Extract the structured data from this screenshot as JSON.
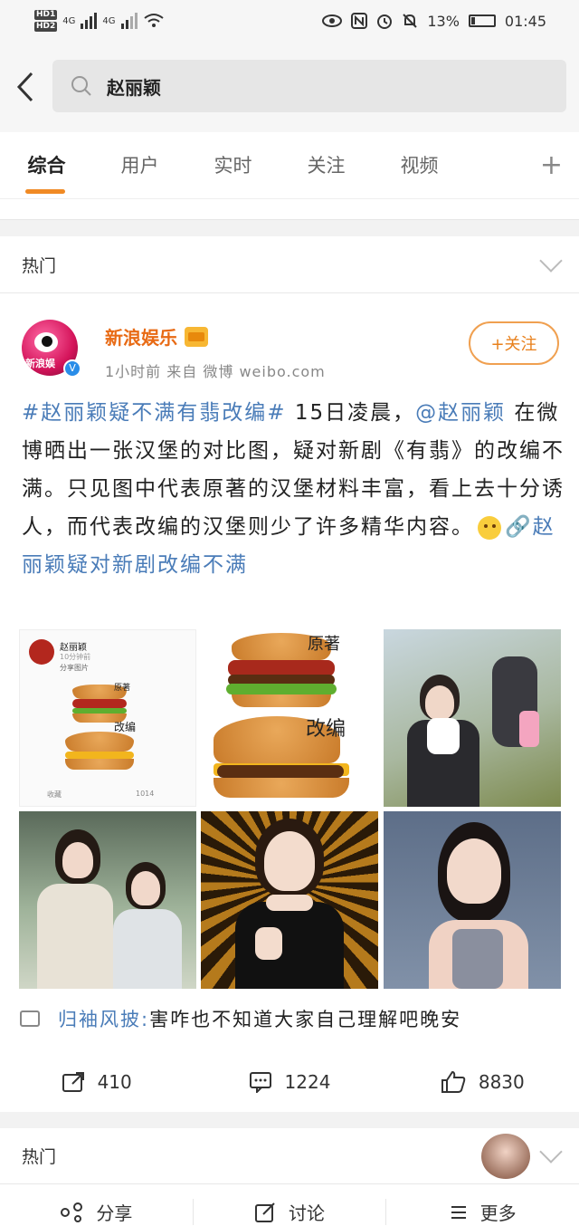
{
  "status_bar": {
    "battery": "13%",
    "time": "01:45",
    "net1": "4G",
    "net2": "4G"
  },
  "search": {
    "query": "赵丽颖"
  },
  "tabs": [
    {
      "label": "综合"
    },
    {
      "label": "用户"
    },
    {
      "label": "实时"
    },
    {
      "label": "关注"
    },
    {
      "label": "视频"
    }
  ],
  "section_title": "热门",
  "post": {
    "author": "新浪娱乐",
    "avatar_text": "新浪娱",
    "meta": "1小时前  来自 微博 weibo.com",
    "follow_label": "+关注",
    "text_hashtag": "#赵丽颖疑不满有翡改编#",
    "text_part1": " 15日凌晨，",
    "text_mention": "@赵丽颖",
    "text_part2": " 在微博晒出一张汉堡的对比图，疑对新剧《有翡》的改编不满。只见图中代表原著的汉堡材料丰富，看上去十分诱人，而代表改编的汉堡则少了许多精华内容。",
    "text_link": "🔗赵丽颖疑对新剧改编不满",
    "images": {
      "label_original": "原著",
      "label_adapted": "改编",
      "small_author": "赵丽颖",
      "small_sub": "10分钟前",
      "small_share": "分享图片",
      "small_fav": "收藏",
      "small_repost": "1014"
    },
    "comment_author": "归袖风披:",
    "comment_text": "害咋也不知道大家自己理解吧晚安",
    "stats": {
      "reposts": "410",
      "comments": "1224",
      "likes": "8830"
    }
  },
  "section2_title": "热门",
  "bottom_bar": [
    {
      "label": "分享",
      "icon": "share-icon"
    },
    {
      "label": "讨论",
      "icon": "edit-icon"
    },
    {
      "label": "更多",
      "icon": "menu-icon"
    }
  ]
}
